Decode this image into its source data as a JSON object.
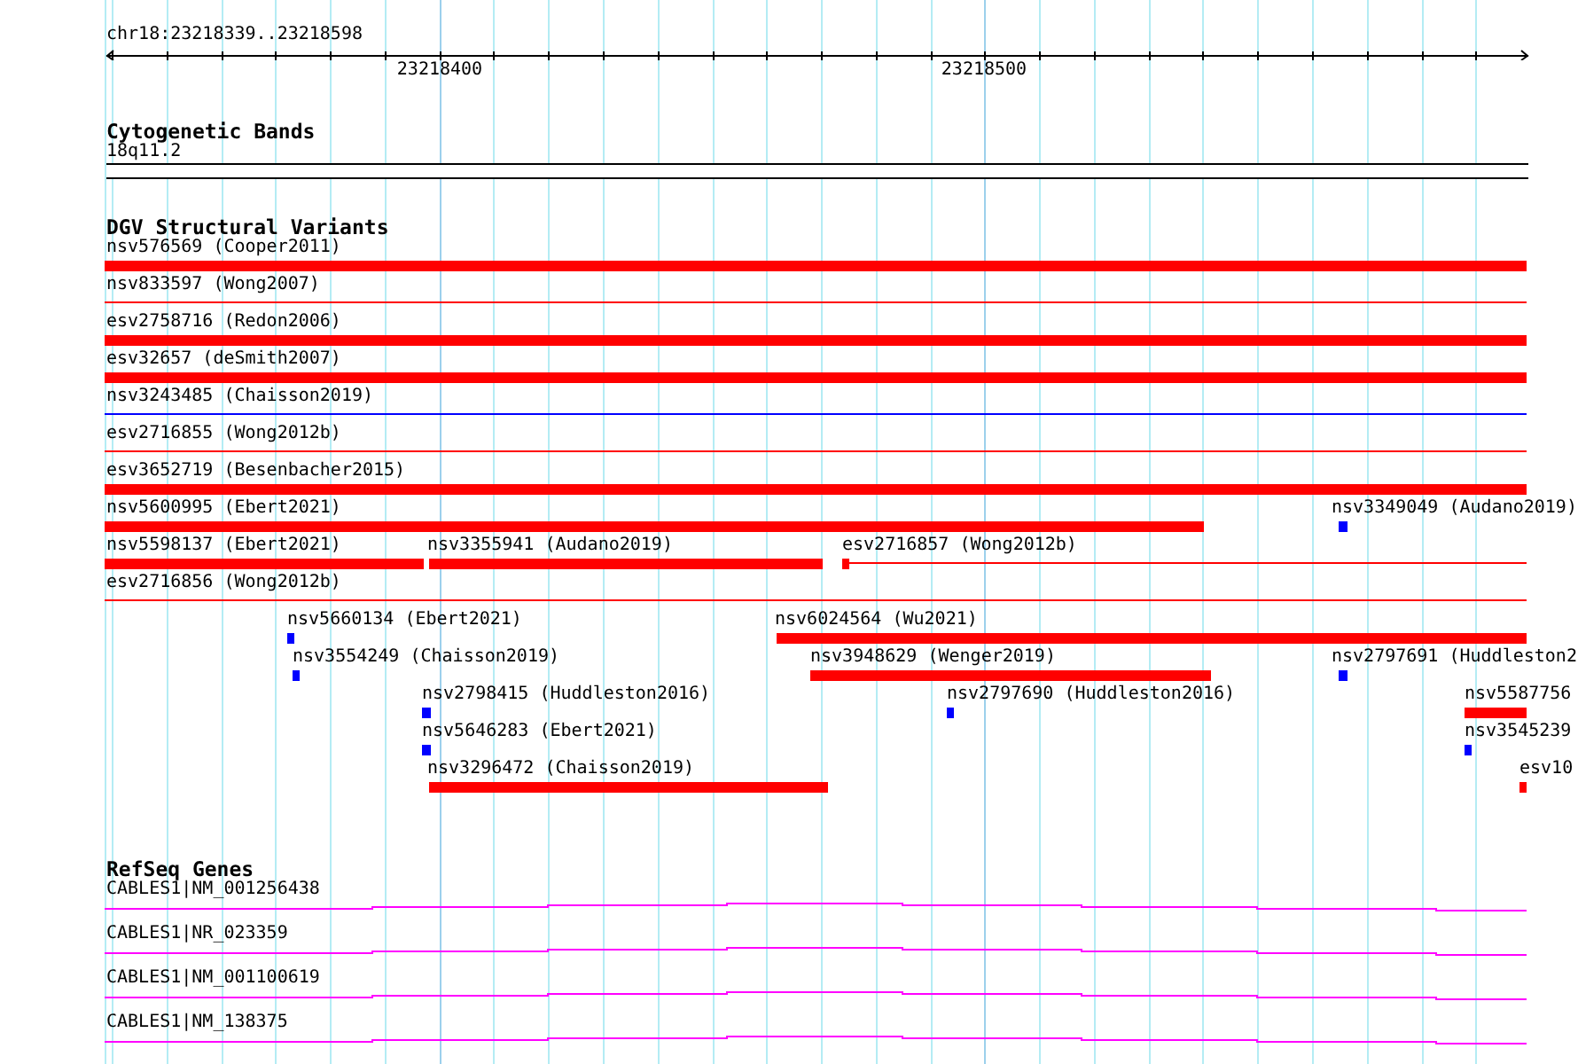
{
  "ruler": {
    "region": "chr18:23218339..23218598",
    "ticks": [
      {
        "label": "23218400"
      },
      {
        "label": "23218500"
      }
    ]
  },
  "tracks": [
    {
      "kind": "cytoband",
      "title": "Cytogenetic Bands",
      "bands": [
        {
          "label": "18q11.2"
        }
      ]
    },
    {
      "kind": "variants",
      "title": "DGV Structural Variants",
      "rows": [
        {
          "features": [
            {
              "label": "nsv576569 (Cooper2011)",
              "kind": "bar",
              "color": "#ff0000"
            }
          ]
        },
        {
          "features": [
            {
              "label": "nsv833597 (Wong2007)",
              "kind": "line",
              "color": "#ff0000"
            }
          ]
        },
        {
          "features": [
            {
              "label": "esv2758716 (Redon2006)",
              "kind": "bar",
              "color": "#ff0000"
            }
          ]
        },
        {
          "features": [
            {
              "label": "esv32657 (deSmith2007)",
              "kind": "bar",
              "color": "#ff0000"
            }
          ]
        },
        {
          "features": [
            {
              "label": "nsv3243485 (Chaisson2019)",
              "kind": "line",
              "color": "#0000ff"
            }
          ]
        },
        {
          "features": [
            {
              "label": "esv2716855 (Wong2012b)",
              "kind": "line",
              "color": "#ff0000"
            }
          ]
        },
        {
          "features": [
            {
              "label": "esv3652719 (Besenbacher2015)",
              "kind": "bar",
              "color": "#ff0000"
            }
          ]
        },
        {
          "features": [
            {
              "label": "nsv5600995 (Ebert2021)",
              "kind": "bar",
              "color": "#ff0000"
            },
            {
              "label": "nsv3349049 (Audano2019)",
              "kind": "mark",
              "color": "#0000ff"
            }
          ]
        },
        {
          "features": [
            {
              "label": "nsv5598137 (Ebert2021)",
              "kind": "bar",
              "color": "#ff0000"
            },
            {
              "label": "nsv3355941 (Audano2019)",
              "kind": "bar",
              "color": "#ff0000"
            },
            {
              "label": "esv2716857 (Wong2012b)",
              "kind": "mark-line",
              "color": "#ff0000"
            }
          ]
        },
        {
          "features": [
            {
              "label": "esv2716856 (Wong2012b)",
              "kind": "line",
              "color": "#ff0000"
            }
          ]
        },
        {
          "features": [
            {
              "label": "nsv5660134 (Ebert2021)",
              "kind": "mark",
              "color": "#0000ff"
            },
            {
              "label": "nsv6024564 (Wu2021)",
              "kind": "bar",
              "color": "#ff0000"
            }
          ]
        },
        {
          "features": [
            {
              "label": "nsv3554249 (Chaisson2019)",
              "kind": "mark",
              "color": "#0000ff"
            },
            {
              "label": "nsv3948629 (Wenger2019)",
              "kind": "bar",
              "color": "#ff0000"
            },
            {
              "label": "nsv2797691 (Huddleston2",
              "kind": "mark",
              "color": "#0000ff"
            }
          ]
        },
        {
          "features": [
            {
              "label": "nsv2798415 (Huddleston2016)",
              "kind": "mark",
              "color": "#0000ff"
            },
            {
              "label": "nsv2797690 (Huddleston2016)",
              "kind": "mark",
              "color": "#0000ff"
            },
            {
              "label": "nsv5587756",
              "kind": "bar",
              "color": "#ff0000"
            }
          ]
        },
        {
          "features": [
            {
              "label": "nsv5646283 (Ebert2021)",
              "kind": "mark",
              "color": "#0000ff"
            },
            {
              "label": "nsv3545239",
              "kind": "mark",
              "color": "#0000ff"
            }
          ]
        },
        {
          "features": [
            {
              "label": "nsv3296472 (Chaisson2019)",
              "kind": "bar",
              "color": "#ff0000"
            },
            {
              "label": "esv10",
              "kind": "mark",
              "color": "#ff0000"
            }
          ]
        }
      ]
    },
    {
      "kind": "genes",
      "title": "RefSeq Genes",
      "genes": [
        {
          "label": "CABLES1|NM_001256438"
        },
        {
          "label": "CABLES1|NR_023359"
        },
        {
          "label": "CABLES1|NM_001100619"
        },
        {
          "label": "CABLES1|NM_138375"
        }
      ]
    }
  ]
}
